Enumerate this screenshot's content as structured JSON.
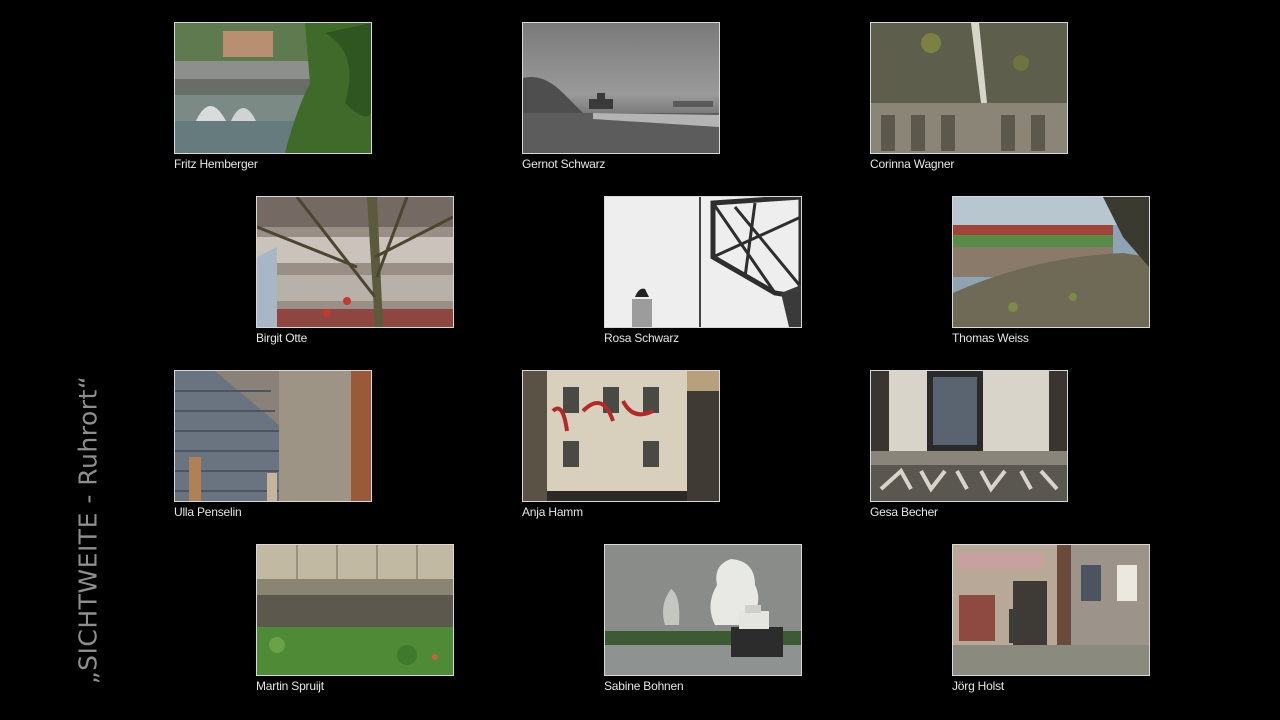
{
  "title": "„SICHTWEITE - Ruhrort“",
  "photos": [
    {
      "photographer": "Fritz Hemberger"
    },
    {
      "photographer": "Gernot Schwarz"
    },
    {
      "photographer": "Corinna Wagner"
    },
    {
      "photographer": "Birgit Otte"
    },
    {
      "photographer": "Rosa Schwarz"
    },
    {
      "photographer": "Thomas Weiss"
    },
    {
      "photographer": "Ulla Penselin"
    },
    {
      "photographer": "Anja Hamm"
    },
    {
      "photographer": "Gesa Becher"
    },
    {
      "photographer": "Martin Spruijt"
    },
    {
      "photographer": "Sabine Bohnen"
    },
    {
      "photographer": "Jörg Holst"
    }
  ],
  "colors": {
    "background": "#000000",
    "caption": "#e6e6e6",
    "title": "#8e8e8e",
    "frame": "#d8d8d8"
  }
}
